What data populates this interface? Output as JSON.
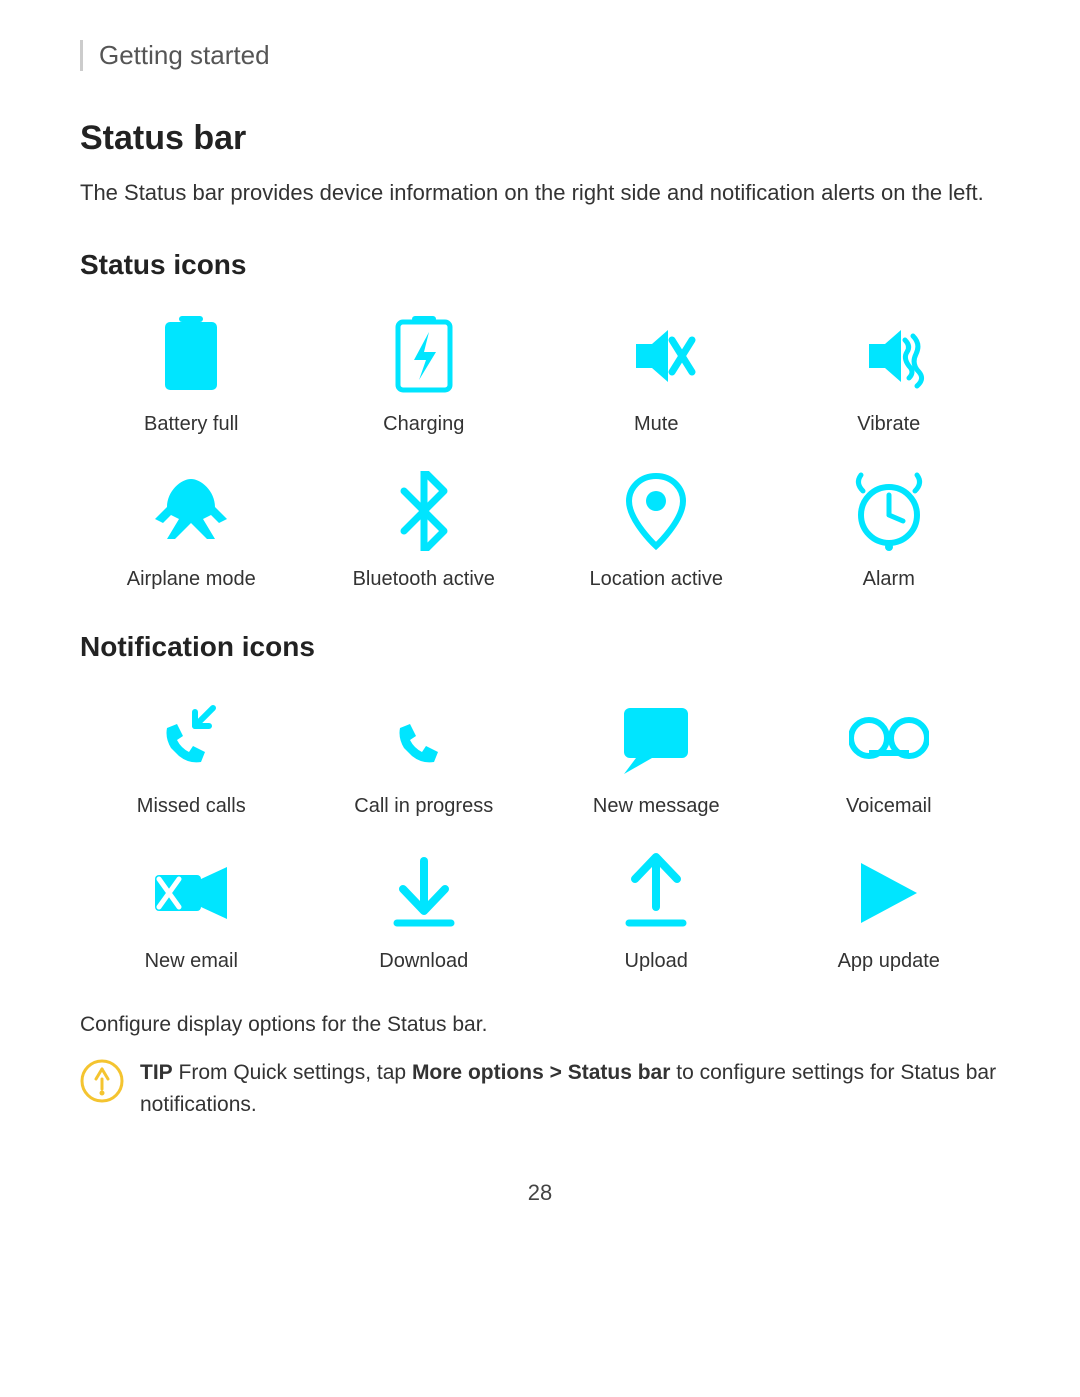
{
  "breadcrumb": "Getting started",
  "section": {
    "title": "Status bar",
    "description": "The Status bar provides device information on the right side and notification alerts on the left."
  },
  "status_icons_title": "Status icons",
  "status_icons": [
    {
      "label": "Battery full",
      "icon": "battery-full"
    },
    {
      "label": "Charging",
      "icon": "charging"
    },
    {
      "label": "Mute",
      "icon": "mute"
    },
    {
      "label": "Vibrate",
      "icon": "vibrate"
    },
    {
      "label": "Airplane mode",
      "icon": "airplane"
    },
    {
      "label": "Bluetooth active",
      "icon": "bluetooth"
    },
    {
      "label": "Location active",
      "icon": "location"
    },
    {
      "label": "Alarm",
      "icon": "alarm"
    }
  ],
  "notification_icons_title": "Notification icons",
  "notification_icons": [
    {
      "label": "Missed calls",
      "icon": "missed-calls"
    },
    {
      "label": "Call in progress",
      "icon": "call-in-progress"
    },
    {
      "label": "New message",
      "icon": "new-message"
    },
    {
      "label": "Voicemail",
      "icon": "voicemail"
    },
    {
      "label": "New email",
      "icon": "new-email"
    },
    {
      "label": "Download",
      "icon": "download"
    },
    {
      "label": "Upload",
      "icon": "upload"
    },
    {
      "label": "App update",
      "icon": "app-update"
    }
  ],
  "configure_text": "Configure display options for the Status bar.",
  "tip": {
    "prefix": "TIP",
    "text": " From Quick settings, tap ",
    "bold": "More options > Status bar",
    "suffix": " to configure settings for Status bar notifications."
  },
  "page_number": "28",
  "accent_color": "#00e5ff"
}
